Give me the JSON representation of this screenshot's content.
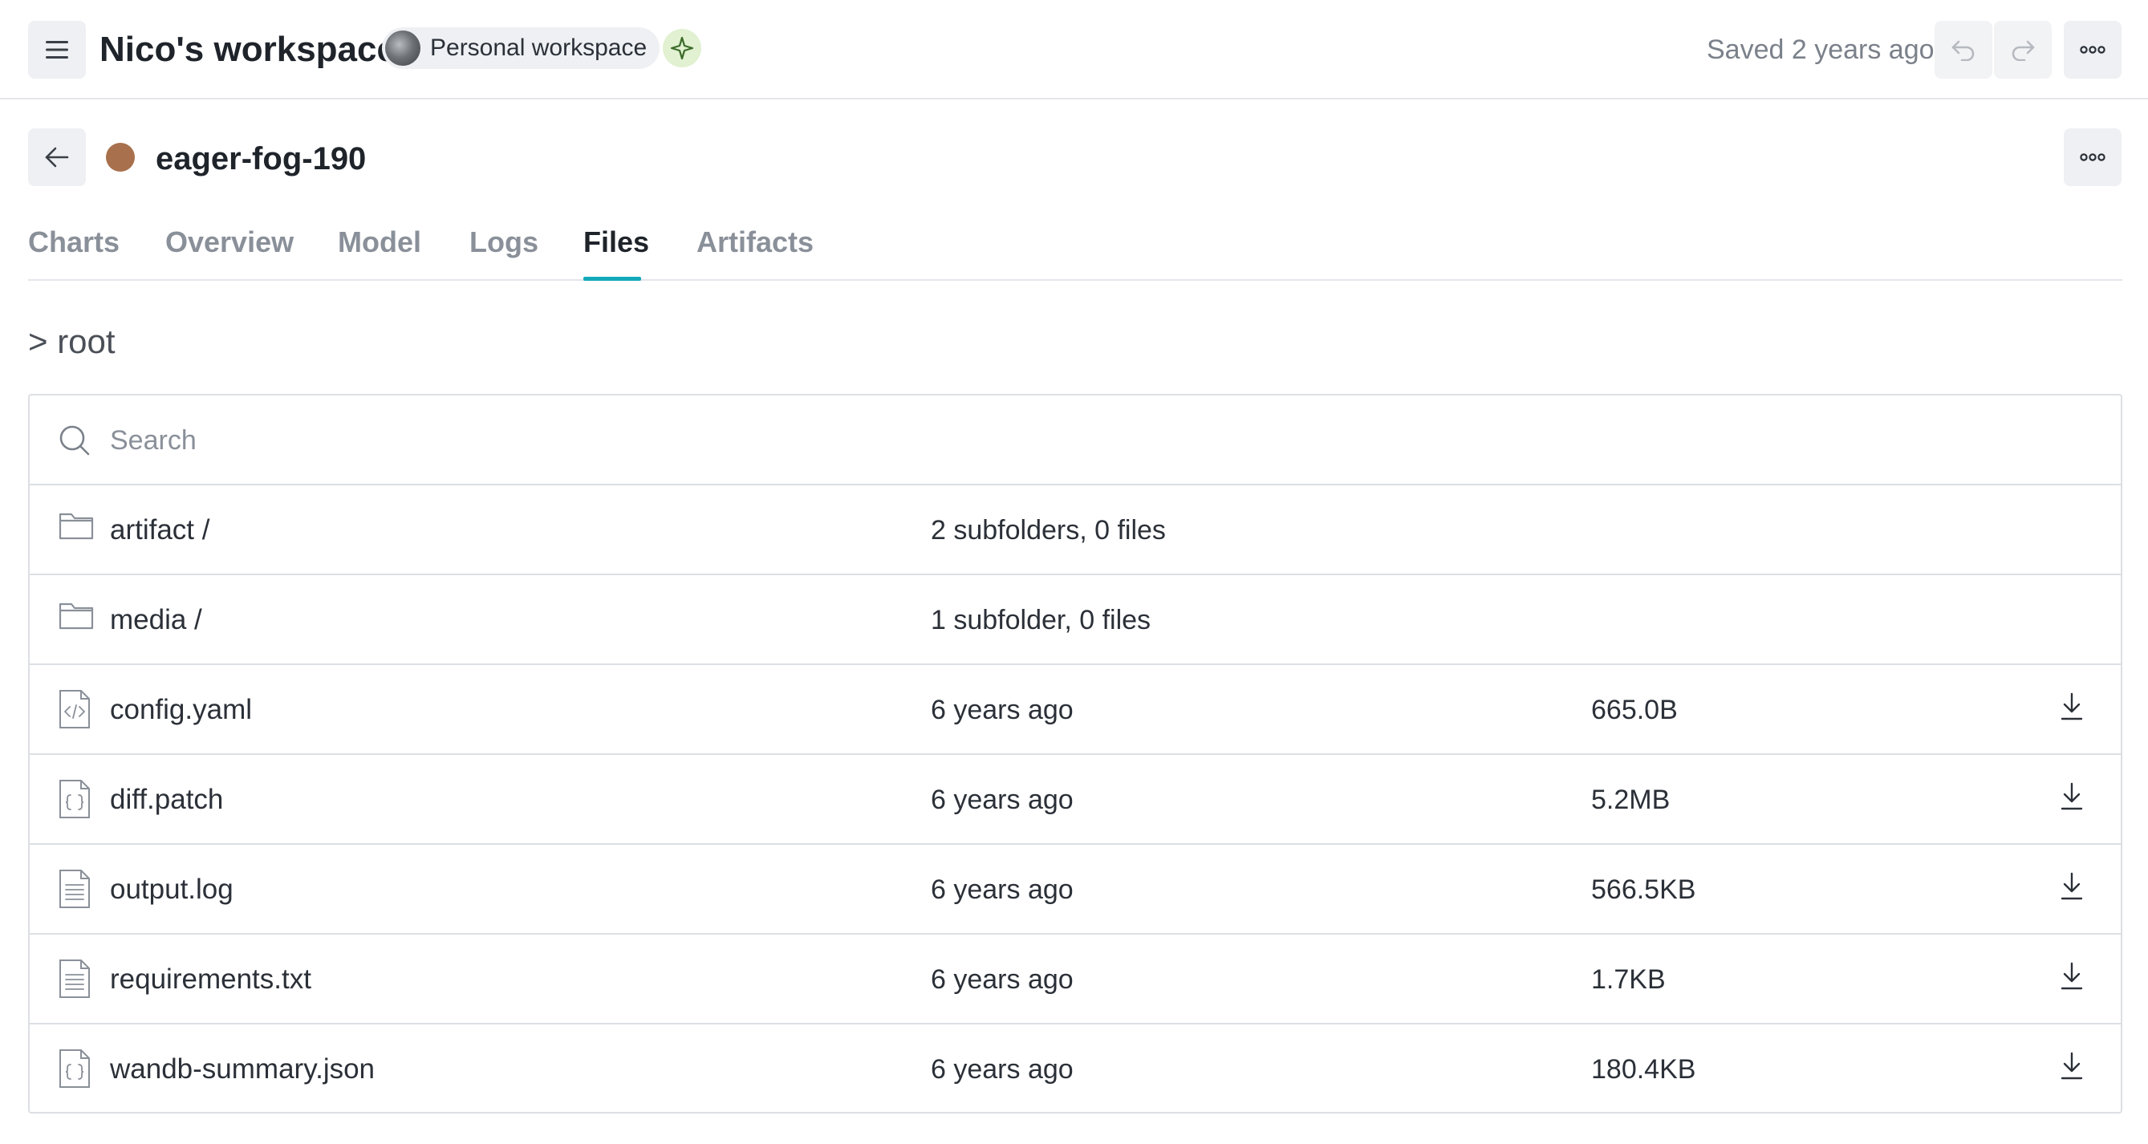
{
  "header": {
    "workspace_title": "Nico's workspace",
    "workspace_pill": "Personal workspace",
    "saved_status": "Saved 2 years ago",
    "icons": [
      "menu-icon",
      "sparkle-icon",
      "undo-icon",
      "redo-icon",
      "more-icon"
    ]
  },
  "run": {
    "name": "eager-fog-190",
    "color": "#a8704c"
  },
  "tabs": [
    {
      "label": "Charts",
      "active": false
    },
    {
      "label": "Overview",
      "active": false
    },
    {
      "label": "Model",
      "active": false
    },
    {
      "label": "Logs",
      "active": false
    },
    {
      "label": "Files",
      "active": true
    },
    {
      "label": "Artifacts",
      "active": false
    }
  ],
  "breadcrumb": "> root",
  "search": {
    "placeholder": "Search",
    "value": ""
  },
  "folders": [
    {
      "name": "artifact /",
      "meta": "2 subfolders, 0 files",
      "icon": "folder-icon"
    },
    {
      "name": "media /",
      "meta": "1 subfolder, 0 files",
      "icon": "folder-icon"
    }
  ],
  "files": [
    {
      "name": "config.yaml",
      "modified": "6 years ago",
      "size": "665.0B",
      "icon": "code-file-icon"
    },
    {
      "name": "diff.patch",
      "modified": "6 years ago",
      "size": "5.2MB",
      "icon": "json-file-icon"
    },
    {
      "name": "output.log",
      "modified": "6 years ago",
      "size": "566.5KB",
      "icon": "text-file-icon"
    },
    {
      "name": "requirements.txt",
      "modified": "6 years ago",
      "size": "1.7KB",
      "icon": "text-file-icon"
    },
    {
      "name": "wandb-summary.json",
      "modified": "6 years ago",
      "size": "180.4KB",
      "icon": "json-file-icon"
    }
  ],
  "colors": {
    "accent": "#13a9ba",
    "border": "#dcdfe4",
    "muted_text": "#8a9099"
  }
}
